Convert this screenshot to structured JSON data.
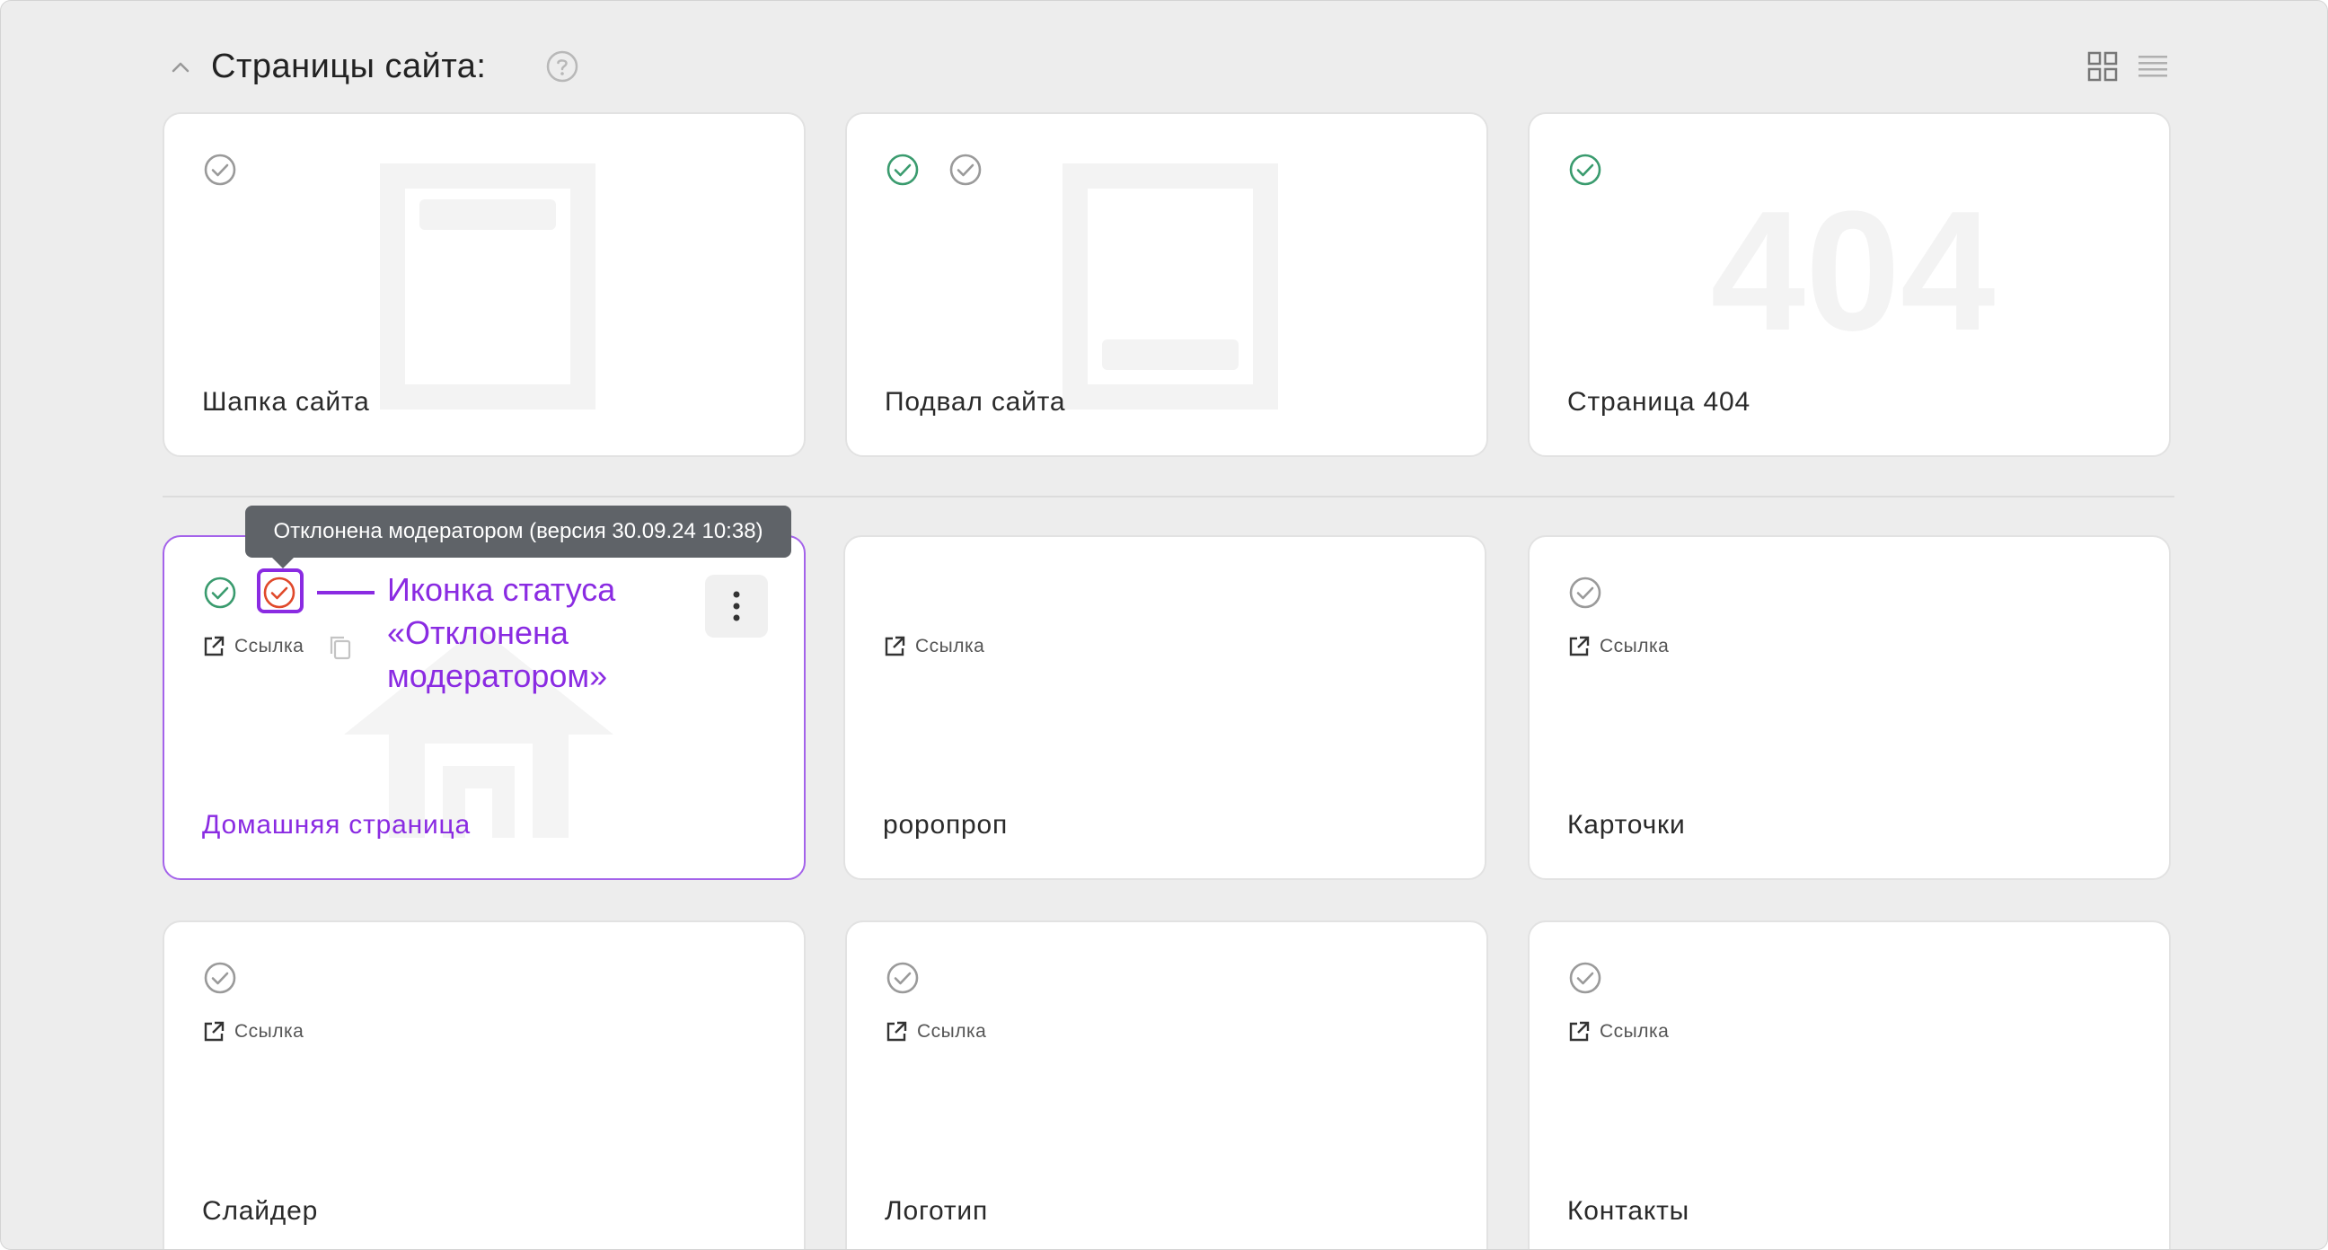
{
  "section": {
    "title": "Страницы сайта:",
    "help_icon": "question-circle-icon",
    "collapse_icon": "chevron-up-icon",
    "view_modes": [
      "grid-view-icon",
      "list-view-icon"
    ]
  },
  "colors": {
    "accent": "#8a2be2",
    "status_ok": "#3a9b6e",
    "status_neutral": "#9a9a9a",
    "status_rejected": "#e0492a",
    "tooltip_bg": "#5f6368"
  },
  "system_pages": [
    {
      "title": "Шапка сайта",
      "statuses": [
        "neutral"
      ],
      "art": "header-page-illustration"
    },
    {
      "title": "Подвал сайта",
      "statuses": [
        "ok",
        "neutral"
      ],
      "art": "footer-page-illustration"
    },
    {
      "title": "Страница 404",
      "statuses": [
        "ok"
      ],
      "art": "404-illustration",
      "art_text": "404"
    }
  ],
  "pages": [
    {
      "title": "Домашняя страница",
      "statuses": [
        "ok",
        "rejected"
      ],
      "link_label": "Ссылка",
      "active": true
    },
    {
      "title": "роропроп",
      "statuses": [],
      "link_label": "Ссылка"
    },
    {
      "title": "Карточки",
      "statuses": [
        "neutral"
      ],
      "link_label": "Ссылка"
    },
    {
      "title": "Слайдер",
      "statuses": [
        "neutral"
      ],
      "link_label": "Ссылка"
    },
    {
      "title": "Логотип",
      "statuses": [
        "neutral"
      ],
      "link_label": "Ссылка"
    },
    {
      "title": "Контакты",
      "statuses": [
        "neutral"
      ],
      "link_label": "Ссылка"
    }
  ],
  "tooltip": {
    "text": "Отклонена модератором (версия 30.09.24 10:38)"
  },
  "callout": {
    "lines": [
      "Иконка статуса",
      "«Отклонена",
      "модератором»"
    ]
  }
}
